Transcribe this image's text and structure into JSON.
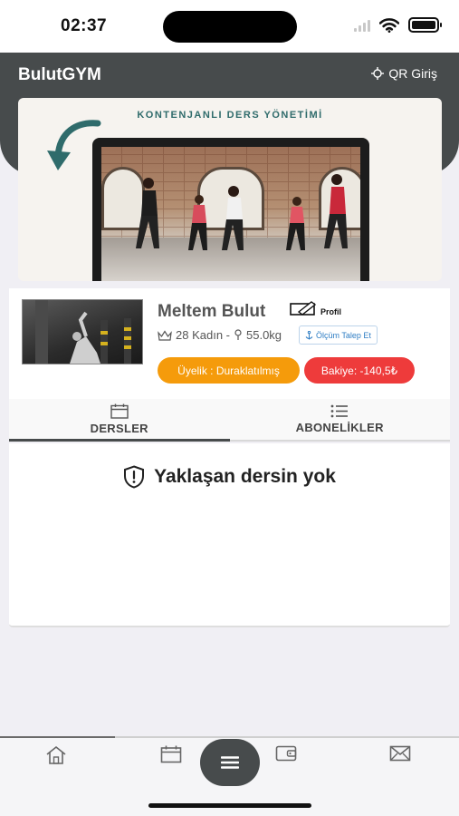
{
  "status_bar": {
    "time": "02:37"
  },
  "header": {
    "title": "BulutGYM",
    "qr_label": "QR Giriş"
  },
  "banner": {
    "caption": "KONTENJANLI DERS YÖNETİMİ"
  },
  "profile": {
    "name": "Meltem Bulut",
    "edit_label": "Profil",
    "age_gender": "28 Kadın -",
    "weight": "55.0kg",
    "measure_button": "Ölçüm Talep Et",
    "membership_status": "Üyelik : Duraklatılmış",
    "balance": "Bakiye: -140,5₺"
  },
  "tabs": [
    {
      "label": "DERSLER",
      "icon": "calendar-icon",
      "active": true
    },
    {
      "label": "ABONELİKLER",
      "icon": "list-icon",
      "active": false
    }
  ],
  "content": {
    "empty_message": "Yaklaşan dersin yok"
  },
  "bottom_nav": {
    "items": [
      "home-icon",
      "calendar-icon",
      "wallet-icon",
      "mail-icon"
    ],
    "center_button": "menu-icon"
  },
  "colors": {
    "header": "#474b4c",
    "membership_badge": "#f59b0b",
    "balance_badge": "#ee3b3b",
    "measure_link": "#2f7ec4",
    "banner_caption": "#2f6b6b"
  }
}
